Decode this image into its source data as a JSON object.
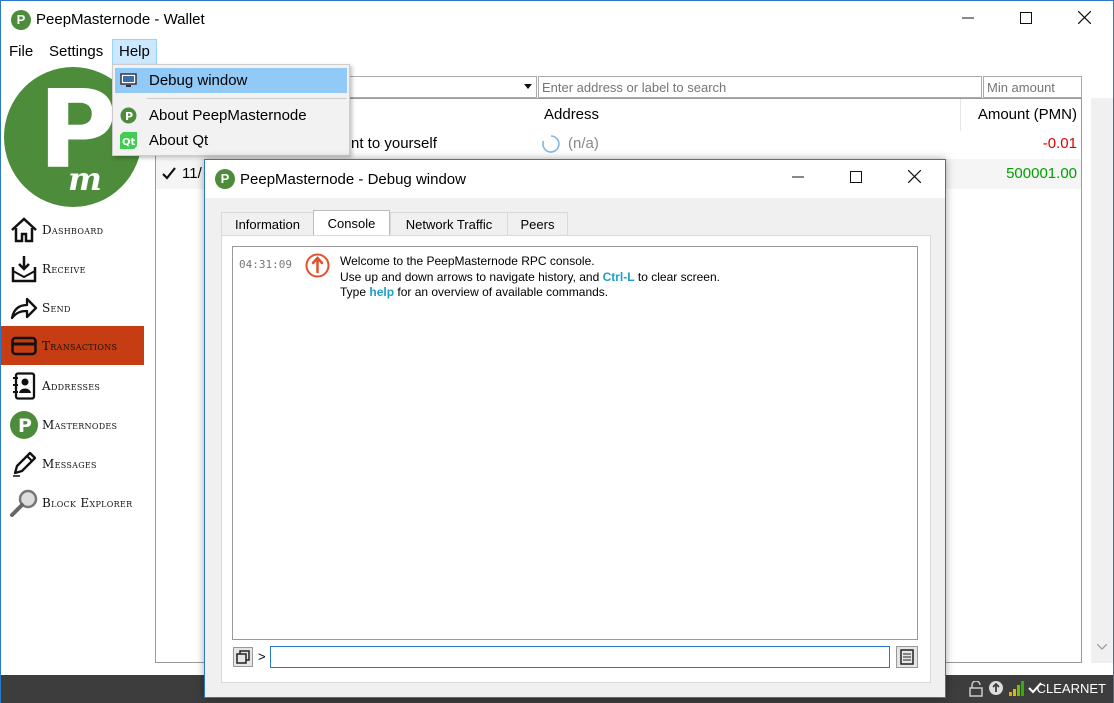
{
  "window": {
    "title": "PeepMasternode - Wallet",
    "app_icon_letter": "P",
    "minimize": "—",
    "maximize": "☐",
    "close": "✕"
  },
  "menu": {
    "file": "File",
    "settings": "Settings",
    "help": "Help"
  },
  "help_menu": {
    "items": [
      {
        "label": "Debug window",
        "icon": "monitor-icon",
        "highlighted": true
      },
      {
        "label": "About PeepMasternode",
        "icon": "peepmasternode-logo-icon"
      },
      {
        "label": "About Qt",
        "icon": "qt-logo-icon"
      }
    ]
  },
  "sidebar": {
    "logo_letter": "P",
    "logo_sub": "m",
    "items": [
      {
        "label": "Dashboard",
        "icon": "home-icon"
      },
      {
        "label": "Receive",
        "icon": "receive-icon"
      },
      {
        "label": "Send",
        "icon": "send-arrow-icon"
      },
      {
        "label": "Transactions",
        "icon": "credit-card-icon",
        "active": true
      },
      {
        "label": "Addresses",
        "icon": "address-book-icon"
      },
      {
        "label": "Masternodes",
        "icon": "masternode-logo-icon"
      },
      {
        "label": "Messages",
        "icon": "pencil-icon"
      },
      {
        "label": "Block Explorer",
        "icon": "magnifier-icon"
      }
    ],
    "active_color": "#c73d13"
  },
  "filters": {
    "address_placeholder": "Enter address or label to search",
    "amount_placeholder": "Min amount"
  },
  "transactions": {
    "columns": {
      "address": "Address",
      "amount": "Amount (PMN)"
    },
    "rows": [
      {
        "date": "",
        "type": "nt to yourself",
        "address": "(n/a)",
        "amount": "-0.01",
        "amount_color": "#e00000"
      },
      {
        "date": "11/",
        "type": "",
        "address": "",
        "amount": "500001.00",
        "amount_color": "#00a000"
      }
    ]
  },
  "status": {
    "network": "CLEARNET"
  },
  "debug_window": {
    "title": "PeepMasternode - Debug window",
    "tabs": [
      "Information",
      "Console",
      "Network Traffic",
      "Peers"
    ],
    "active_tab": "Console",
    "console": {
      "timestamp": "04:31:09",
      "line1": "Welcome to the PeepMasternode RPC console.",
      "line2_pre": "Use up and down arrows to navigate history, and ",
      "line2_kw": "Ctrl-L",
      "line2_post": " to clear screen.",
      "line3_pre": "Type ",
      "line3_kw": "help",
      "line3_post": " for an overview of available commands.",
      "prompt": ">",
      "input_value": ""
    }
  }
}
